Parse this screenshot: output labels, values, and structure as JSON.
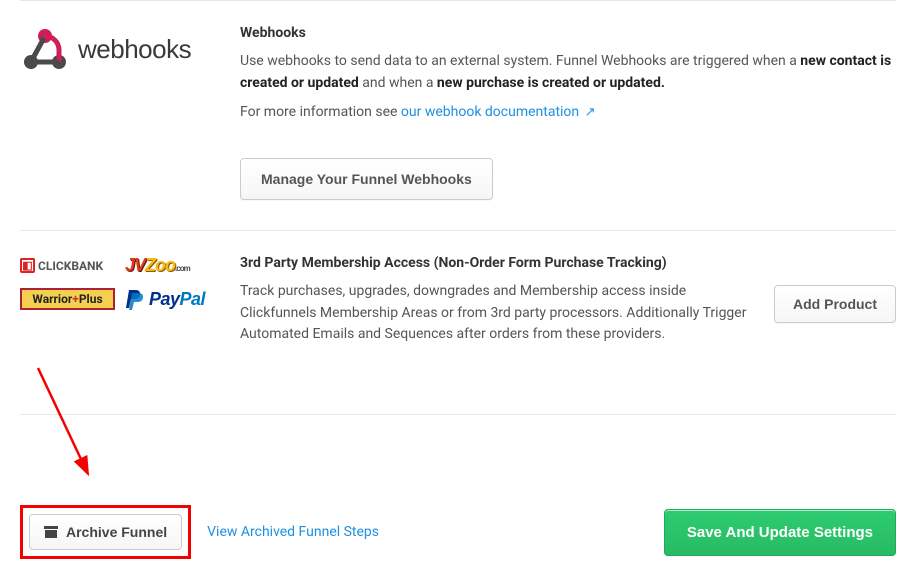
{
  "webhooks": {
    "logo_text": "webhooks",
    "title": "Webhooks",
    "desc_prefix": "Use webhooks to send data to an external system. Funnel Webhooks are triggered when a ",
    "desc_bold1": "new contact is created or updated",
    "desc_mid": " and when a ",
    "desc_bold2": "new purchase is created or updated.",
    "more_prefix": "For more information see ",
    "doc_link_label": "our webhook documentation",
    "manage_button": "Manage Your Funnel Webhooks"
  },
  "thirdparty": {
    "title": "3rd Party Membership Access (Non-Order Form Purchase Tracking)",
    "desc": "Track purchases, upgrades, downgrades and Membership access inside Clickfunnels Membership Areas or from 3rd party processors. Additionally Trigger Automated Emails and Sequences after orders from these providers.",
    "add_product_label": "Add Product",
    "providers": {
      "clickbank": "CLICKBANK",
      "jvzoo_a": "JV",
      "jvzoo_b": "Zoo",
      "jvzoo_c": ".com",
      "warrior_a": "Warrior",
      "warrior_b": "+",
      "warrior_c": "Plus",
      "paypal_a": "Pay",
      "paypal_b": "Pal"
    }
  },
  "footer": {
    "archive_label": "Archive Funnel",
    "view_archived_label": "View Archived Funnel Steps",
    "save_label": "Save And Update Settings"
  }
}
